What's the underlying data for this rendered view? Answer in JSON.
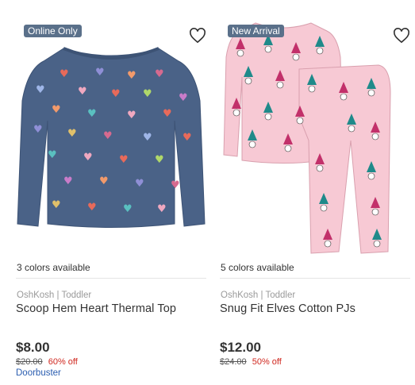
{
  "products": [
    {
      "badge": "Online Only",
      "colors_available": "3 colors available",
      "brand": "OshKosh | Toddler",
      "title": "Scoop Hem Heart Thermal Top",
      "price": "$8.00",
      "was_price": "$20.00",
      "discount": "60% off",
      "promo": "Doorbuster",
      "garment_color": "#4a6287"
    },
    {
      "badge": "New Arrival",
      "colors_available": "5 colors available",
      "brand": "OshKosh | Toddler",
      "title": "Snug Fit Elves Cotton PJs",
      "price": "$12.00",
      "was_price": "$24.00",
      "discount": "50% off",
      "promo": "",
      "garment_color": "#f7c9d4"
    }
  ],
  "icons": {
    "wishlist": "heart-outline-icon"
  },
  "colors": {
    "badge_bg": "#5a708a",
    "sale_red": "#d0281f",
    "promo_blue": "#2a5db0"
  }
}
